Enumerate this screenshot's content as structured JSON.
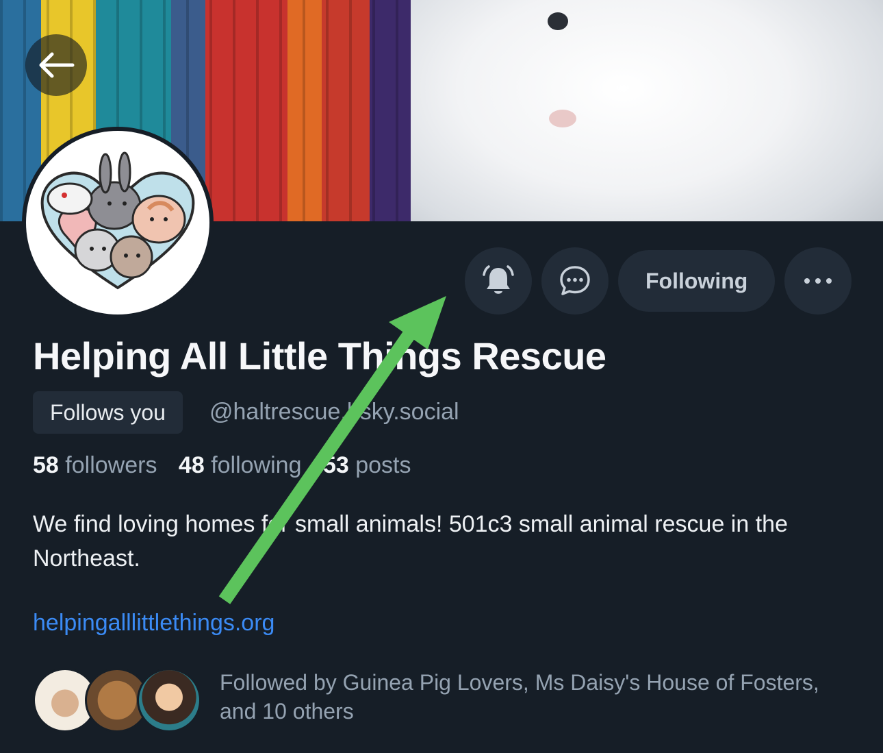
{
  "profile": {
    "display_name": "Helping All Little Things Rescue",
    "follows_you_badge": "Follows you",
    "handle": "@haltrescue.bsky.social",
    "stats": {
      "followers_count": "58",
      "followers_label": "followers",
      "following_count": "48",
      "following_label": "following",
      "posts_count": "53",
      "posts_label": "posts"
    },
    "bio": "We find loving homes for small animals! 501c3 small animal rescue in the Northeast.",
    "link": "helpingalllittlethings.org",
    "followed_by": "Followed by Guinea Pig Lovers, Ms Daisy's House of Fosters, and 10 others"
  },
  "actions": {
    "notifications_icon": "bell-ringing-icon",
    "message_icon": "chat-bubble-icon",
    "following_label": "Following",
    "more_icon": "ellipsis-icon"
  },
  "nav": {
    "back_icon": "arrow-left-icon"
  },
  "colors": {
    "background": "#161e27",
    "button_bg": "#222c38",
    "link": "#3b8bf5",
    "muted_text": "#95a3b2",
    "annotation_arrow": "#5cc35c"
  }
}
